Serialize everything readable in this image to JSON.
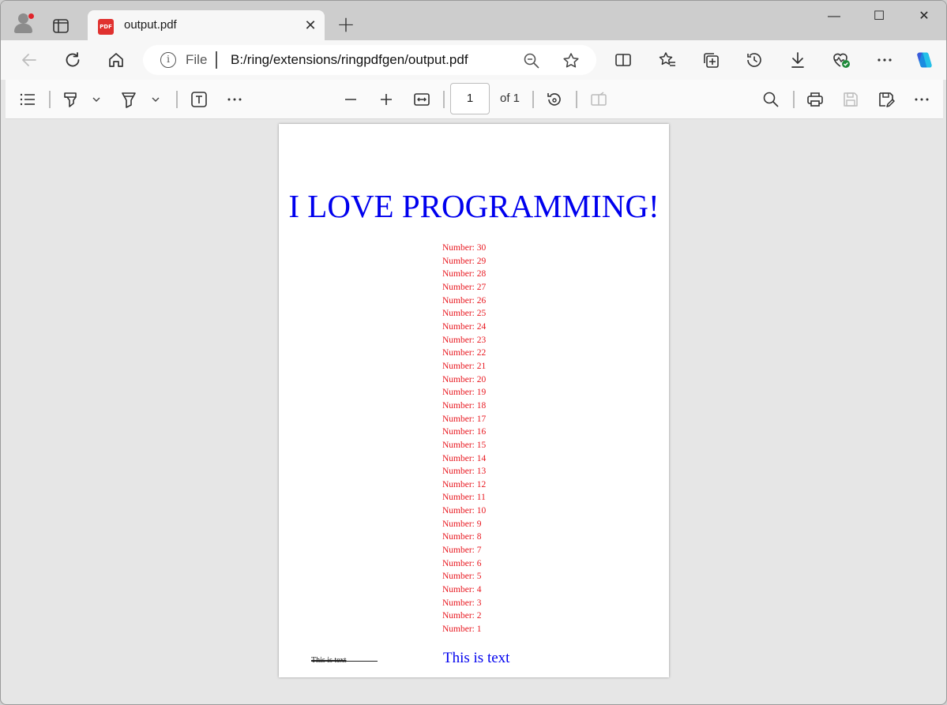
{
  "browser": {
    "tab": {
      "title": "output.pdf",
      "favicon_text": "PDF",
      "close_glyph": "✕"
    },
    "new_tab_glyph": "+",
    "window_controls": {
      "minimize": "—",
      "maximize": "☐",
      "close": "✕"
    },
    "address": {
      "scheme": "File",
      "url": "B:/ring/extensions/ringpdfgen/output.pdf"
    },
    "icons": [
      "back-icon",
      "refresh-icon",
      "home-icon",
      "info-icon",
      "zoom-out-icon",
      "favorite-star-icon",
      "split-screen-icon",
      "favorites-icon",
      "collections-icon",
      "history-icon",
      "download-icon",
      "browser-essentials-icon",
      "more-icon",
      "copilot-icon"
    ]
  },
  "pdf_toolbar": {
    "page_number": "1",
    "page_total": "of 1",
    "icons": [
      "contents-icon",
      "highlight-icon",
      "draw-icon",
      "add-text-icon",
      "more-tools-icon",
      "zoom-out-icon",
      "zoom-in-icon",
      "fit-to-width-icon",
      "rotate-icon",
      "page-view-icon",
      "search-icon",
      "print-icon",
      "save-icon",
      "save-as-icon",
      "more-options-icon"
    ]
  },
  "document": {
    "headline": "I LOVE PROGRAMMING!",
    "numbers": [
      "Number: 30",
      "Number: 29",
      "Number: 28",
      "Number: 27",
      "Number: 26",
      "Number: 25",
      "Number: 24",
      "Number: 23",
      "Number: 22",
      "Number: 21",
      "Number: 20",
      "Number: 19",
      "Number: 18",
      "Number: 17",
      "Number: 16",
      "Number: 15",
      "Number: 14",
      "Number: 13",
      "Number: 12",
      "Number: 11",
      "Number: 10",
      "Number: 9",
      "Number: 8",
      "Number: 7",
      "Number: 6",
      "Number: 5",
      "Number: 4",
      "Number: 3",
      "Number: 2",
      "Number: 1"
    ],
    "small_text": "This is text",
    "blue_text": "This is text"
  },
  "colors": {
    "headline": "#0000ee",
    "numbers": "#e8171f",
    "pdf_badge": "#e0312f"
  }
}
